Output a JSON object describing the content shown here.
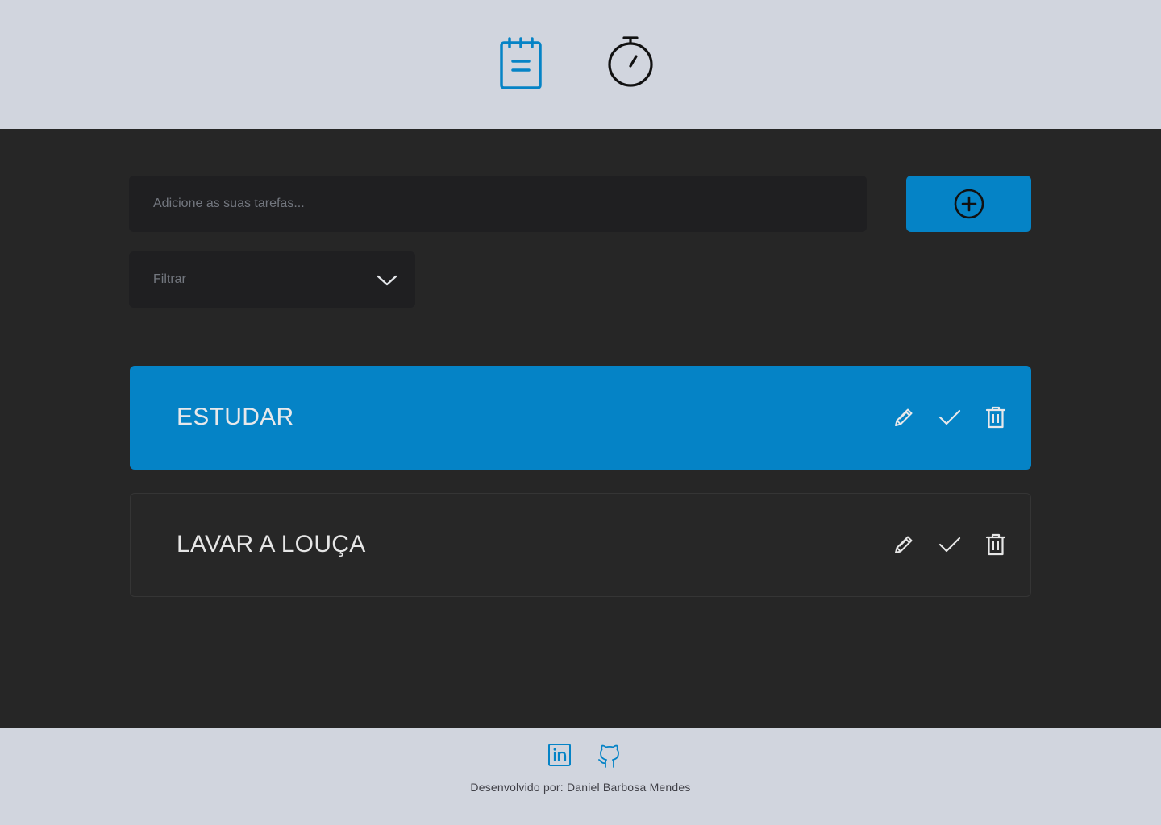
{
  "header": {
    "nav": [
      {
        "icon": "notepad-icon",
        "color": "#0583c6",
        "active": true
      },
      {
        "icon": "stopwatch-icon",
        "color": "#111111",
        "active": false
      }
    ]
  },
  "form": {
    "input_placeholder": "Adicione as suas tarefas...",
    "input_value": "",
    "add_button_icon": "plus-circle-icon",
    "filter_label": "Filtrar"
  },
  "tasks": [
    {
      "title": "ESTUDAR",
      "highlighted": true
    },
    {
      "title": "LAVAR A LOUÇA",
      "highlighted": false
    }
  ],
  "task_actions": [
    "pencil-icon",
    "check-icon",
    "trash-icon"
  ],
  "footer": {
    "social": [
      "linkedin-icon",
      "github-icon"
    ],
    "credit": "Desenvolvido por: Daniel Barbosa Mendes"
  },
  "colors": {
    "accent": "#0583c6",
    "header_bg": "#d1d5de",
    "main_bg": "#262626",
    "field_bg": "#1f1f21"
  }
}
